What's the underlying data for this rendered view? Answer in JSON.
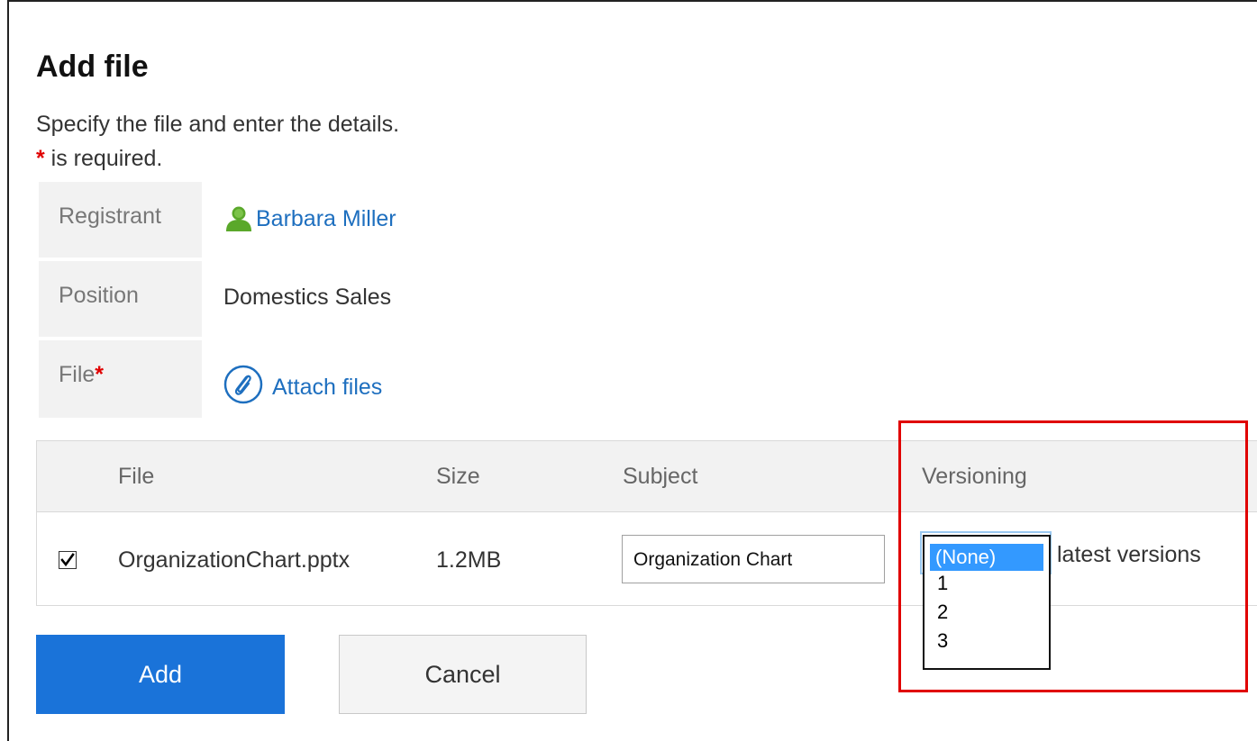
{
  "page": {
    "title": "Add file",
    "description": "Specify the file and enter the details.",
    "required_star": "*",
    "required_note": " is required."
  },
  "form": {
    "registrant": {
      "label": "Registrant",
      "value": "Barbara Miller",
      "icon": "user-icon"
    },
    "position": {
      "label": "Position",
      "value": "Domestics Sales"
    },
    "file": {
      "label": "File",
      "required_star": "*",
      "attach_label": "Attach files",
      "icon": "paperclip-icon"
    }
  },
  "table": {
    "headers": {
      "file": "File",
      "size": "Size",
      "subject": "Subject",
      "versioning": "Versioning"
    },
    "rows": [
      {
        "checked": true,
        "file": "OrganizationChart.pptx",
        "size": "1.2MB",
        "subject": "Organization Chart",
        "versioning": {
          "selected": "(None)",
          "options": [
            "(None)",
            "1",
            "2",
            "3"
          ],
          "suffix": "latest versions"
        }
      }
    ]
  },
  "buttons": {
    "add": "Add",
    "cancel": "Cancel"
  },
  "colors": {
    "primary_button": "#1a73d9",
    "link": "#1e6fbf",
    "required": "#e00000",
    "highlight": "#e00000",
    "option_selected": "#3399ff"
  }
}
